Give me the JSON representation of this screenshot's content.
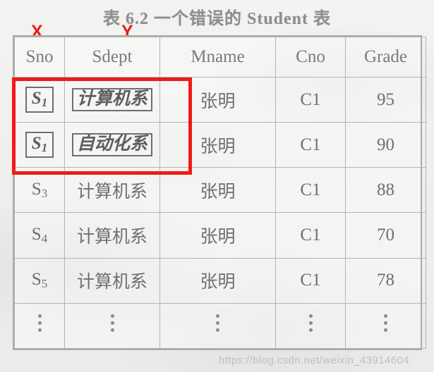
{
  "caption": "表 6.2    一个错误的 Student 表",
  "annotations": {
    "x_label": "X",
    "y_label": "Y",
    "highlight_color": "#ee1b16"
  },
  "table": {
    "headers": [
      "Sno",
      "Sdept",
      "Mname",
      "Cno",
      "Grade"
    ],
    "rows": [
      {
        "sno": "S",
        "sno_sub": "1",
        "sno_boxed": true,
        "sdept": "计算机系",
        "sdept_boxed": true,
        "mname": "张明",
        "cno": "C1",
        "grade": "95",
        "highlighted": true
      },
      {
        "sno": "S",
        "sno_sub": "1",
        "sno_boxed": true,
        "sdept": "自动化系",
        "sdept_boxed": true,
        "mname": "张明",
        "cno": "C1",
        "grade": "90",
        "highlighted": true
      },
      {
        "sno": "S",
        "sno_sub": "3",
        "sno_boxed": false,
        "sdept": "计算机系",
        "sdept_boxed": false,
        "mname": "张明",
        "cno": "C1",
        "grade": "88",
        "highlighted": false
      },
      {
        "sno": "S",
        "sno_sub": "4",
        "sno_boxed": false,
        "sdept": "计算机系",
        "sdept_boxed": false,
        "mname": "张明",
        "cno": "C1",
        "grade": "70",
        "highlighted": false
      },
      {
        "sno": "S",
        "sno_sub": "5",
        "sno_boxed": false,
        "sdept": "计算机系",
        "sdept_boxed": false,
        "mname": "张明",
        "cno": "C1",
        "grade": "78",
        "highlighted": false
      }
    ],
    "continuation_row": {
      "symbol": "vertical-ellipsis",
      "cells": [
        "⋮",
        "⋮",
        "⋮",
        "⋮",
        "⋮"
      ]
    }
  },
  "watermark": "https://blog.csdn.net/weixin_43914604"
}
